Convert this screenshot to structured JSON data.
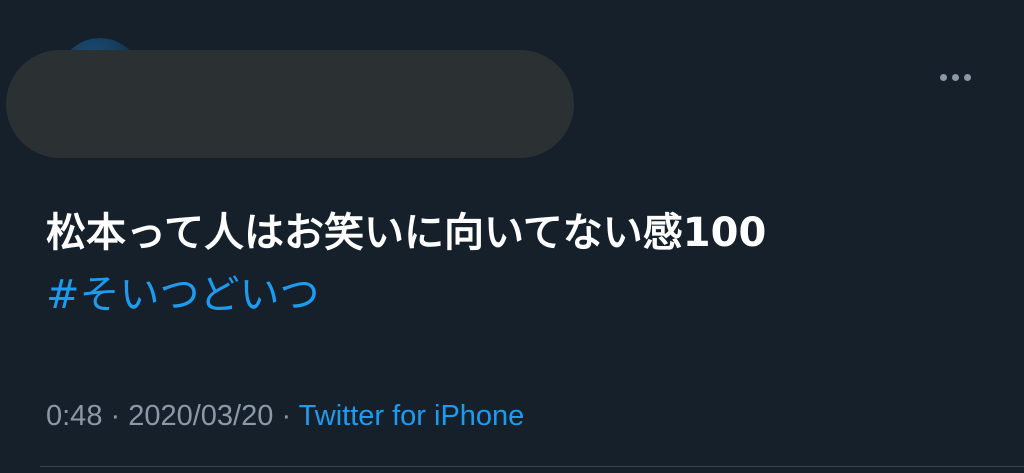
{
  "tweet": {
    "text_line1": "松本って人はお笑いに向いてない感100",
    "hashtag": "#そいつどいつ",
    "time": "0:48",
    "separator": " · ",
    "date": "2020/03/20",
    "source": "Twitter for iPhone"
  },
  "icons": {
    "more": "more-horizontal-icon"
  },
  "colors": {
    "background": "#15202b",
    "text_primary": "#ffffff",
    "text_secondary": "#8b98a5",
    "accent": "#1d9bf0",
    "redaction": "#2b3033",
    "divider": "#38444d"
  }
}
